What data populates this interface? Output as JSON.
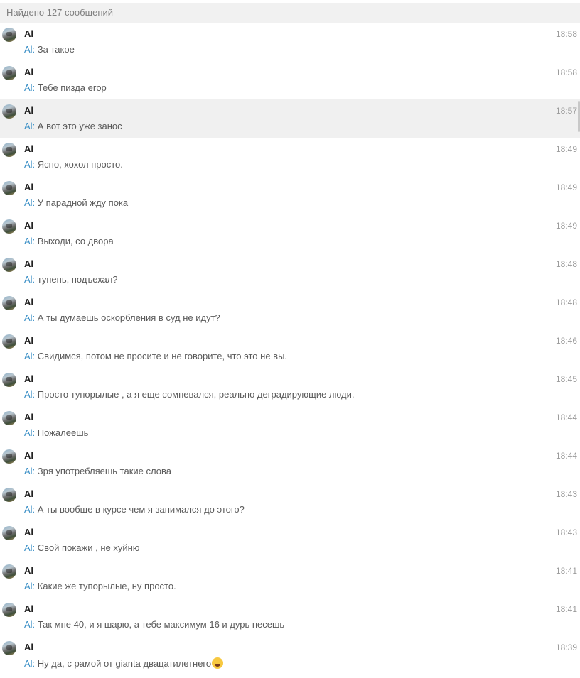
{
  "header": {
    "text": "Найдено 127 сообщений"
  },
  "sender_prefix": "Al:",
  "messages": [
    {
      "name": "Al",
      "time": "18:58",
      "text": "За такое"
    },
    {
      "name": "Al",
      "time": "18:58",
      "text": "Тебе пизда егор"
    },
    {
      "name": "Al",
      "time": "18:57",
      "text": "А вот это уже занос"
    },
    {
      "name": "Al",
      "time": "18:49",
      "text": "Ясно, хохол просто."
    },
    {
      "name": "Al",
      "time": "18:49",
      "text": "У парадной жду пока"
    },
    {
      "name": "Al",
      "time": "18:49",
      "text": "Выходи, со двора"
    },
    {
      "name": "Al",
      "time": "18:48",
      "text": "тупень, подъехал?"
    },
    {
      "name": "Al",
      "time": "18:48",
      "text": "А ты думаешь оскорбления в суд не идут?"
    },
    {
      "name": "Al",
      "time": "18:46",
      "text": "Свидимся, потом не просите и не говорите, что это не вы."
    },
    {
      "name": "Al",
      "time": "18:45",
      "text": "Просто тупорылые , а я еще сомневался, реально деградирующие люди."
    },
    {
      "name": "Al",
      "time": "18:44",
      "text": "Пожалеешь"
    },
    {
      "name": "Al",
      "time": "18:44",
      "text": "Зря употребляешь такие слова"
    },
    {
      "name": "Al",
      "time": "18:43",
      "text": "А ты вообще в курсе чем я занимался до этого?"
    },
    {
      "name": "Al",
      "time": "18:43",
      "text": "Свой покажи , не хуйню"
    },
    {
      "name": "Al",
      "time": "18:41",
      "text": "Какие же тупорылые, ну просто."
    },
    {
      "name": "Al",
      "time": "18:41",
      "text": "Так мне 40, и я шарю, а тебе максимум 16 и дурь несешь"
    },
    {
      "name": "Al",
      "time": "18:39",
      "text": "Ну да, с рамой от gianta двацатилетнего"
    }
  ],
  "last_message_emoji": "laughing-tears-emoji"
}
